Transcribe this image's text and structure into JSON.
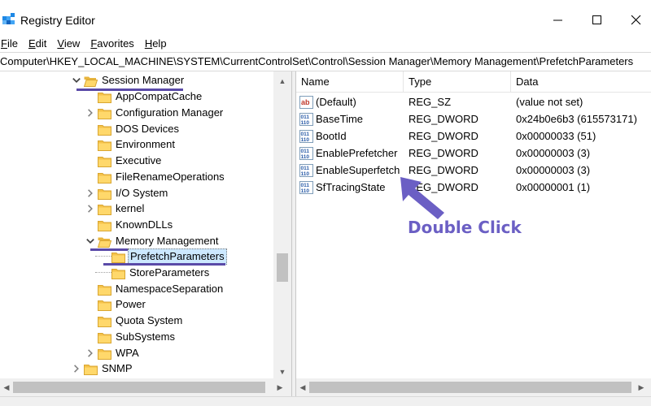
{
  "window": {
    "title": "Registry Editor",
    "controls": {
      "minimize": "minimize",
      "maximize": "maximize",
      "close": "close"
    }
  },
  "menu": [
    {
      "accel": "F",
      "rest": "ile"
    },
    {
      "accel": "E",
      "rest": "dit"
    },
    {
      "accel": "V",
      "rest": "iew"
    },
    {
      "accel": "F",
      "rest": "avorites"
    },
    {
      "accel": "H",
      "rest": "elp"
    }
  ],
  "address": "Computer\\HKEY_LOCAL_MACHINE\\SYSTEM\\CurrentControlSet\\Control\\Session Manager\\Memory Management\\PrefetchParameters",
  "tree": {
    "session_manager": "Session Manager",
    "app_compat_cache": "AppCompatCache",
    "configuration_manager": "Configuration Manager",
    "dos_devices": "DOS Devices",
    "environment": "Environment",
    "executive": "Executive",
    "file_rename_operations": "FileRenameOperations",
    "io_system": "I/O System",
    "kernel": "kernel",
    "known_dlls": "KnownDLLs",
    "memory_management": "Memory Management",
    "prefetch_parameters": "PrefetchParameters",
    "store_parameters": "StoreParameters",
    "namespace_separation": "NamespaceSeparation",
    "power": "Power",
    "quota_system": "Quota System",
    "subsystems": "SubSystems",
    "wpa": "WPA",
    "snmp": "SNMP"
  },
  "list": {
    "columns": {
      "name": "Name",
      "type": "Type",
      "data": "Data"
    },
    "rows": [
      {
        "icon": "string-value-icon",
        "name": "(Default)",
        "type": "REG_SZ",
        "data": "(value not set)"
      },
      {
        "icon": "dword-value-icon",
        "name": "BaseTime",
        "type": "REG_DWORD",
        "data": "0x24b0e6b3 (615573171)"
      },
      {
        "icon": "dword-value-icon",
        "name": "BootId",
        "type": "REG_DWORD",
        "data": "0x00000033 (51)"
      },
      {
        "icon": "dword-value-icon",
        "name": "EnablePrefetcher",
        "type": "REG_DWORD",
        "data": "0x00000003 (3)"
      },
      {
        "icon": "dword-value-icon",
        "name": "EnableSuperfetch",
        "type": "REG_DWORD",
        "data": "0x00000003 (3)"
      },
      {
        "icon": "dword-value-icon",
        "name": "SfTracingState",
        "type": "REG_DWORD",
        "data": "0x00000001 (1)"
      }
    ]
  },
  "annotation": {
    "text": "Double Click"
  },
  "colors": {
    "annotation": "#6b5fc4",
    "underline": "#5a4aa8",
    "selection": "#cce8ff",
    "folder": "#f5c24a"
  }
}
